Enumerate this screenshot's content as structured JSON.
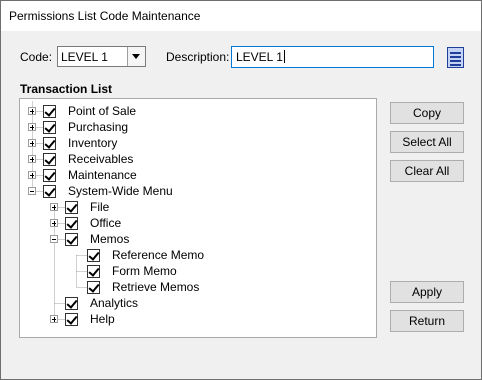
{
  "window": {
    "title": "Permissions List Code Maintenance"
  },
  "form": {
    "code_label": "Code:",
    "code_value": "LEVEL 1",
    "description_label": "Description:",
    "description_value": "LEVEL 1"
  },
  "transaction_list": {
    "heading": "Transaction List",
    "items": [
      {
        "label": "Point of Sale",
        "level": 0,
        "expander": "plus",
        "checked": true
      },
      {
        "label": "Purchasing",
        "level": 0,
        "expander": "plus",
        "checked": true
      },
      {
        "label": "Inventory",
        "level": 0,
        "expander": "plus",
        "checked": true
      },
      {
        "label": "Receivables",
        "level": 0,
        "expander": "plus",
        "checked": true
      },
      {
        "label": "Maintenance",
        "level": 0,
        "expander": "plus",
        "checked": true
      },
      {
        "label": "System-Wide Menu",
        "level": 0,
        "expander": "minus",
        "checked": true
      },
      {
        "label": "File",
        "level": 1,
        "expander": "plus",
        "checked": true
      },
      {
        "label": "Office",
        "level": 1,
        "expander": "plus",
        "checked": true
      },
      {
        "label": "Memos",
        "level": 1,
        "expander": "minus",
        "checked": true
      },
      {
        "label": "Reference Memo",
        "level": 2,
        "expander": "none",
        "checked": true
      },
      {
        "label": "Form Memo",
        "level": 2,
        "expander": "none",
        "checked": true
      },
      {
        "label": "Retrieve Memos",
        "level": 2,
        "expander": "none",
        "checked": true
      },
      {
        "label": "Analytics",
        "level": 1,
        "expander": "none",
        "checked": true
      },
      {
        "label": "Help",
        "level": 1,
        "expander": "plus",
        "checked": true
      }
    ]
  },
  "buttons": {
    "copy": "Copy",
    "select_all": "Select All",
    "clear_all": "Clear All",
    "apply": "Apply",
    "return": "Return"
  }
}
